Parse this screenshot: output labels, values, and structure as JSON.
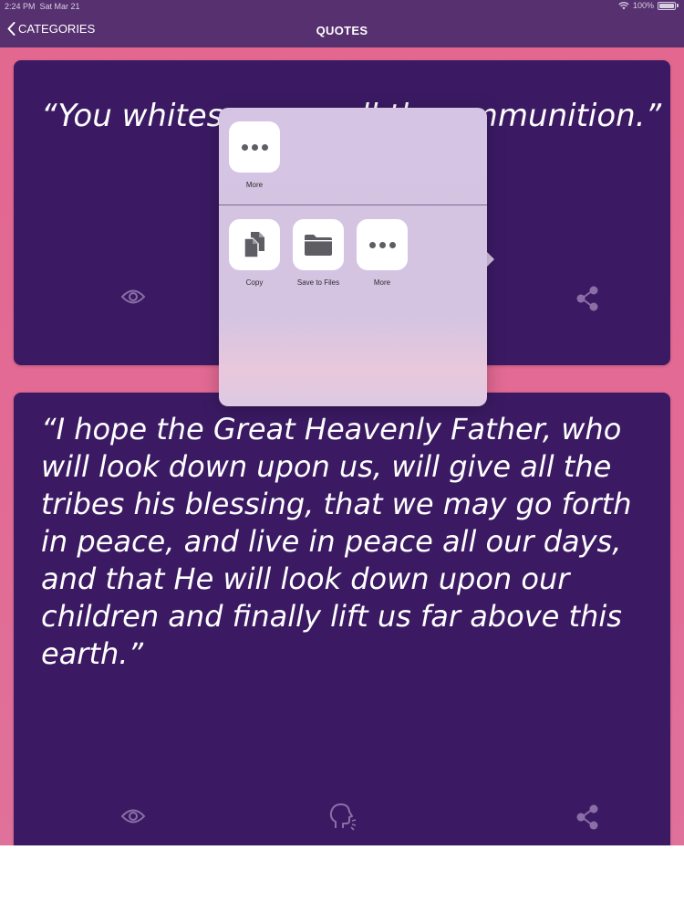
{
  "status_bar": {
    "time": "2:24 PM",
    "date": "Sat Mar 21",
    "battery": "100%"
  },
  "nav": {
    "back_label": "CATEGORIES",
    "title": "QUOTES"
  },
  "quotes": [
    {
      "text": "“You whites              ll the ammunition.”"
    },
    {
      "text": "“I hope the Great Heavenly Father, who will look down upon us, will give all the tribes his blessing, that we may go forth in peace, and live in peace all our days, and that He will look down upon our children and finally lift us far above this earth.”"
    }
  ],
  "share_sheet": {
    "top_actions": [
      {
        "label": "More",
        "icon": "more-icon"
      }
    ],
    "bottom_actions": [
      {
        "label": "Copy",
        "icon": "copy-icon"
      },
      {
        "label": "Save to Files",
        "icon": "folder-icon"
      },
      {
        "label": "More",
        "icon": "more-icon"
      }
    ]
  },
  "colors": {
    "nav_bar": "#56306f",
    "background": "#e3678f",
    "card": "#3b1a63",
    "icon": "#8a6fa6"
  }
}
